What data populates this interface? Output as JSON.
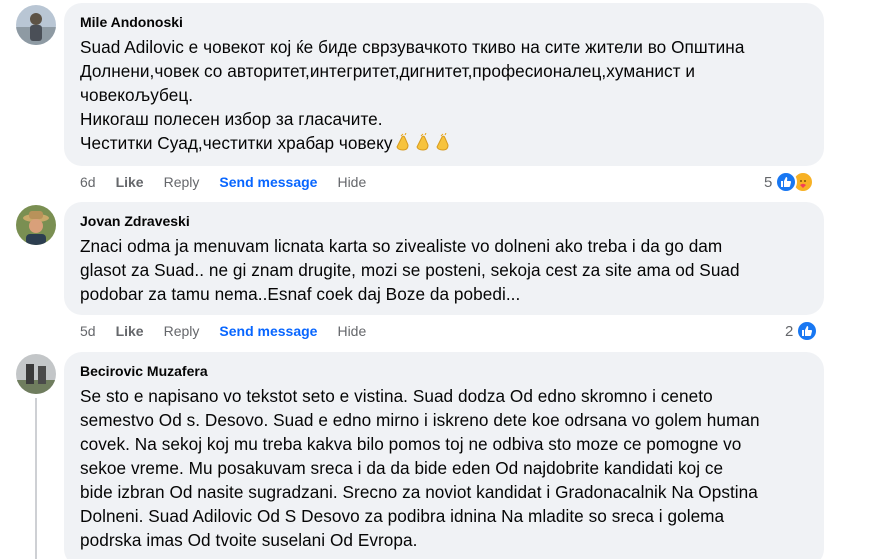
{
  "comments": [
    {
      "author": "Mile Andonoski",
      "text": "Suad Adilovic е човекот кој ќе биде сврзувачкото ткиво на сите жители во Општина\nДолнени,човек со авторитет,интегритет,дигнитет,професионалец,хуманист и\nчовекољубец.\nНикогаш полесен избор за гласачите.",
      "last_line": "Честитки Суад,честитки храбар човеку",
      "emoji": [
        "clapping-hands",
        "clapping-hands",
        "clapping-hands"
      ],
      "age": "6d",
      "like": "Like",
      "reply": "Reply",
      "send": "Send message",
      "hide": "Hide",
      "reaction_count": "5",
      "reactions": [
        "like",
        "care"
      ]
    },
    {
      "author": "Jovan Zdraveski",
      "text": "Znaci odma ja menuvam licnata karta so zivealiste vo dolneni ako treba i da go dam\nglasot za Suad.. ne gi znam drugite, mozi se posteni, sekoja cest za site ama od Suad\npodobar za tamu nema..Esnaf coek daj Boze da pobedi...",
      "age": "5d",
      "like": "Like",
      "reply": "Reply",
      "send": "Send message",
      "hide": "Hide",
      "reaction_count": "2",
      "reactions": [
        "like"
      ]
    },
    {
      "author": "Becirovic Muzafera",
      "text": "Se sto e napisano vo tekstot seto e vistina. Suad dodza Od edno skromno i ceneto\nsemestvo Od s. Desovo. Suad e edno mirno i iskreno dete koe odrsana vo golem human\ncovek. Na sekoj koj mu treba kakva bilo pomos toj ne odbiva sto moze ce pomogne vo\nsekoe vreme. Mu posakuvam sreca i da da bide eden Od najdobrite kandidati koj ce\nbide izbran Od nasite sugradzani. Srecno za noviot kandidat i Gradonacalnik Na Opstina\nDolneni. Suad Adilovic Od S Desovo za podibra idnina Na mladite so sreca i golema\npodrska imas Od tvoite suselani Od Evropa."
    }
  ]
}
